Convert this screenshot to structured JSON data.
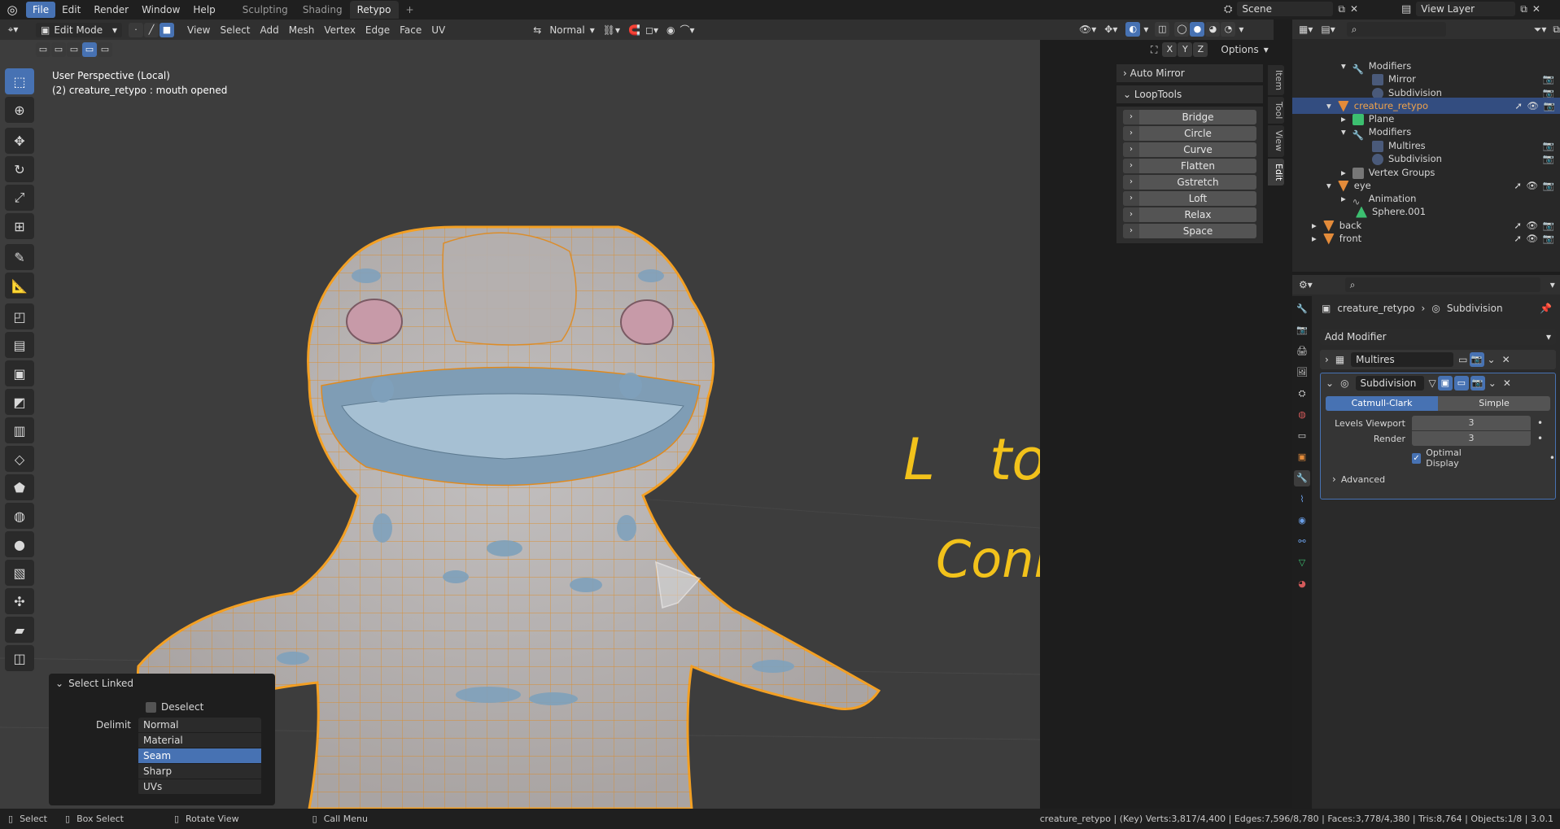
{
  "topbar": {
    "menus": [
      "File",
      "Edit",
      "Render",
      "Window",
      "Help"
    ],
    "workspaces": [
      "Sculpting",
      "Shading",
      "Retypo"
    ],
    "active_workspace": "Retypo",
    "add_workspace": "+",
    "scene": "Scene",
    "view_layer": "View Layer"
  },
  "header": {
    "mode": "Edit Mode",
    "menus": [
      "View",
      "Select",
      "Add",
      "Mesh",
      "Vertex",
      "Edge",
      "Face",
      "UV"
    ],
    "orientation": "Normal",
    "axes": [
      "X",
      "Y",
      "Z"
    ],
    "options": "Options"
  },
  "viewport": {
    "info_line1": "User Perspective (Local)",
    "info_line2": "(2) creature_retypo : mouth opened",
    "annotation_line1": "L   to   select",
    "annotation_line2": "Connected",
    "annotation_color": "#f2c21b"
  },
  "npanel": {
    "sections": [
      "Auto Mirror",
      "LoopTools"
    ],
    "looptools": [
      "Bridge",
      "Circle",
      "Curve",
      "Flatten",
      "Gstretch",
      "Loft",
      "Relax",
      "Space"
    ],
    "tabs": [
      "Item",
      "Tool",
      "View",
      "Edit"
    ]
  },
  "select_linked": {
    "title": "Select Linked",
    "deselect": "Deselect",
    "delimit_label": "Delimit",
    "options": [
      "Normal",
      "Material",
      "Seam",
      "Sharp",
      "UVs"
    ],
    "selected": "Seam"
  },
  "outliner": {
    "rows": [
      {
        "label": "Modifiers",
        "indent": 3
      },
      {
        "label": "Mirror",
        "indent": 4
      },
      {
        "label": "Subdivision",
        "indent": 4
      },
      {
        "label": "creature_retypo",
        "indent": 2
      },
      {
        "label": "Plane",
        "indent": 3
      },
      {
        "label": "Modifiers",
        "indent": 3
      },
      {
        "label": "Multires",
        "indent": 4
      },
      {
        "label": "Subdivision",
        "indent": 4
      },
      {
        "label": "Vertex Groups",
        "indent": 3
      },
      {
        "label": "eye",
        "indent": 2
      },
      {
        "label": "Animation",
        "indent": 3
      },
      {
        "label": "Sphere.001",
        "indent": 3
      },
      {
        "label": "back",
        "indent": 1
      },
      {
        "label": "front",
        "indent": 1
      }
    ]
  },
  "properties": {
    "breadcrumb_object": "creature_retypo",
    "breadcrumb_modifier": "Subdivision",
    "add_modifier": "Add Modifier",
    "modifier1": "Multires",
    "modifier2": "Subdivision",
    "catmull": "Catmull-Clark",
    "simple": "Simple",
    "levels_viewport_label": "Levels Viewport",
    "levels_viewport_value": "3",
    "render_label": "Render",
    "render_value": "3",
    "optimal_display": "Optimal Display",
    "advanced": "Advanced"
  },
  "status": {
    "select": "Select",
    "box_select": "Box Select",
    "rotate_view": "Rotate View",
    "call_menu": "Call Menu",
    "stats": "creature_retypo | (Key) Verts:3,817/4,400 | Edges:7,596/8,780 | Faces:3,778/4,380 | Tris:8,764 | Objects:1/8 | 3.0.1"
  }
}
